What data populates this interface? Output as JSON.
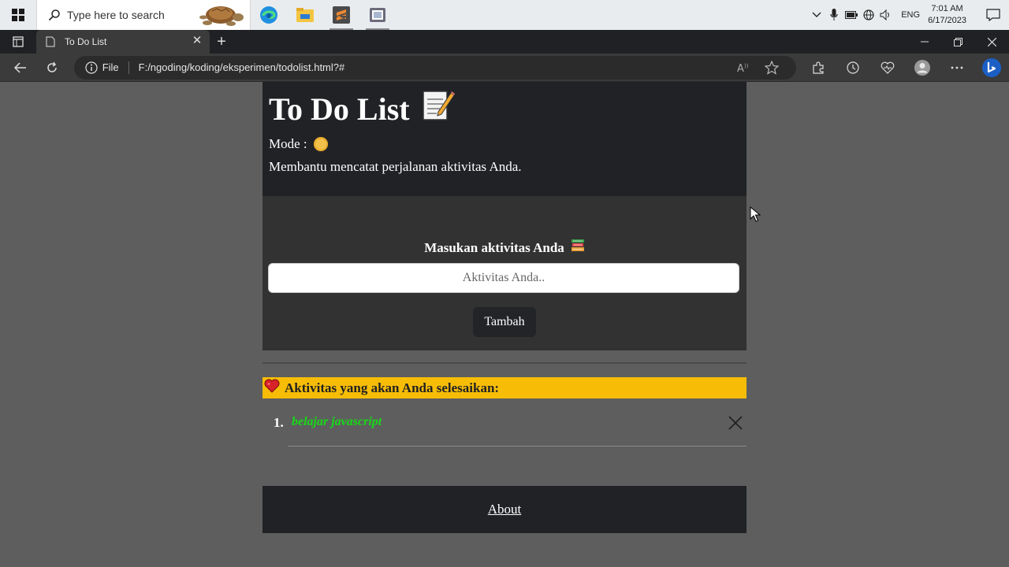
{
  "taskbar": {
    "search_placeholder": "Type here to search",
    "apps": [
      "edge-icon",
      "file-explorer-icon",
      "sublime-text-icon",
      "screen-recorder-icon"
    ],
    "language": "ENG",
    "time": "7:01 AM",
    "date": "6/17/2023"
  },
  "browser": {
    "tab_title": "To Do List",
    "url_scheme_label": "File",
    "url": "F:/ngoding/koding/eksperimen/todolist.html?#"
  },
  "page": {
    "title": "To Do List",
    "mode_label": "Mode :",
    "description": "Membantu mencatat perjalanan aktivitas Anda.",
    "form_label": "Masukan aktivitas Anda",
    "input_placeholder": "Aktivitas Anda..",
    "input_value": "",
    "add_button": "Tambah",
    "list_heading": "Aktivitas yang akan Anda selesaikan:",
    "items": [
      {
        "number": "1.",
        "text": "belajar javascript"
      }
    ],
    "footer_link": "About"
  },
  "colors": {
    "header_bg": "#202225",
    "form_bg": "#323232",
    "list_heading_bg": "#f7bd06",
    "item_text": "#18d918",
    "page_bg": "#5e5e5e"
  }
}
